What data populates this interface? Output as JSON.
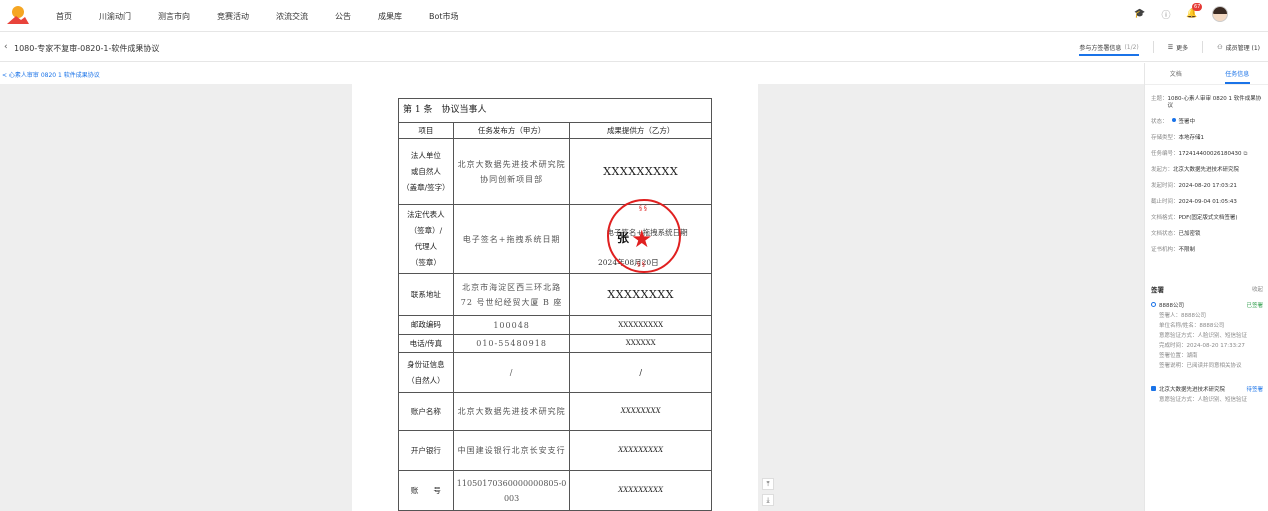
{
  "nav": {
    "items": [
      "首页",
      "川渝动门",
      "测言市向",
      "竞赛活动",
      "浓流交流",
      "公告",
      "成果库",
      "Bot市场"
    ],
    "notif_count": "67"
  },
  "header": {
    "title": "1080-专家不复审-0820-1-软件成果协议",
    "participants_tab": "参与方签署信息",
    "participants_count": "(1/2)",
    "more_label": "更多",
    "manage_label": "成员管理 (1)"
  },
  "breadcrumb": "< 心素人审审 0820 1 软件成果协议",
  "document": {
    "caption": "第 1 条　协议当事人",
    "headers": [
      "项目",
      "任务发布方（甲方）",
      "成果提供方（乙方）"
    ],
    "rows": [
      {
        "label": [
          "法人单位",
          "或自然人",
          "（盖章/签字）"
        ],
        "a": "北京大数据先进技术研究院协同创新项目部",
        "b": "XXXXXXXXX"
      },
      {
        "label": [
          "法定代表人",
          "（签章）/",
          "代理人",
          "（签章）"
        ],
        "a": "电子签名+拖拽系统日期",
        "b": ""
      },
      {
        "label": [
          "联系地址"
        ],
        "a": "北京市海淀区西三环北路 72 号世纪经贸大厦 B 座",
        "b": "XXXXXXXX"
      },
      {
        "label": [
          "邮政编码"
        ],
        "a": "100048",
        "b": "XXXXXXXXX"
      },
      {
        "label": [
          "电话/传真"
        ],
        "a": "010-55480918",
        "b": "XXXXXX"
      },
      {
        "label": [
          "身份证信息",
          "（自然人）"
        ],
        "a": "/",
        "b": "/"
      },
      {
        "label": [
          "账户名称"
        ],
        "a": "北京大数据先进技术研究院",
        "b": "XXXXXXXX"
      },
      {
        "label": [
          "开户银行"
        ],
        "a": "中国建设银行北京长安支行",
        "b": "XXXXXXXXX"
      },
      {
        "label": [
          "账　　号"
        ],
        "a": "11050170360000000805-0003",
        "b": "XXXXXXXXX"
      }
    ],
    "stamp_sig": "张",
    "stamp_note": "电子签名+拖拽系统日期",
    "stamp_date": "2024年08月20日"
  },
  "side": {
    "tabs": [
      "文档",
      "任务信息"
    ],
    "info": [
      {
        "k": "主题：",
        "v": "1080-心素人审审 0820 1 软件成果协议"
      },
      {
        "k": "状态：",
        "v": "签署中"
      },
      {
        "k": "存储类型：",
        "v": "本地存储1"
      },
      {
        "k": "任务编号：",
        "v": "172414400026180430"
      },
      {
        "k": "发起方：",
        "v": "北京大数据先进技术研究院"
      },
      {
        "k": "发起时间：",
        "v": "2024-08-20 17:03:21"
      },
      {
        "k": "截止时间：",
        "v": "2024-09-04 01:05:43"
      },
      {
        "k": "文档格式：",
        "v": "PDF(固定版式文档签署)"
      },
      {
        "k": "文档状态：",
        "v": "已加密锁"
      },
      {
        "k": "证书机构：",
        "v": "不限制"
      }
    ],
    "sign_title": "签署",
    "sign_more": "收起",
    "signers": [
      {
        "name": "8888公司",
        "status": "已签署",
        "details": [
          "签署人：8888公司",
          "单位名称/姓名：8888公司",
          "意愿验证方式：人脸识别、短信验证",
          "完成时间：2024-08-20 17:33:27",
          "签署位置：湖南",
          "签署说明：已阅读并同意相关协议"
        ]
      },
      {
        "name": "北京大数据先进技术研究院",
        "status": "待签署",
        "details": [
          "意愿验证方式：人脸识别、短信验证"
        ]
      }
    ]
  },
  "colors": {
    "accent": "#1a73e8",
    "seal": "#e02020",
    "signed": "#2e9d4a"
  }
}
